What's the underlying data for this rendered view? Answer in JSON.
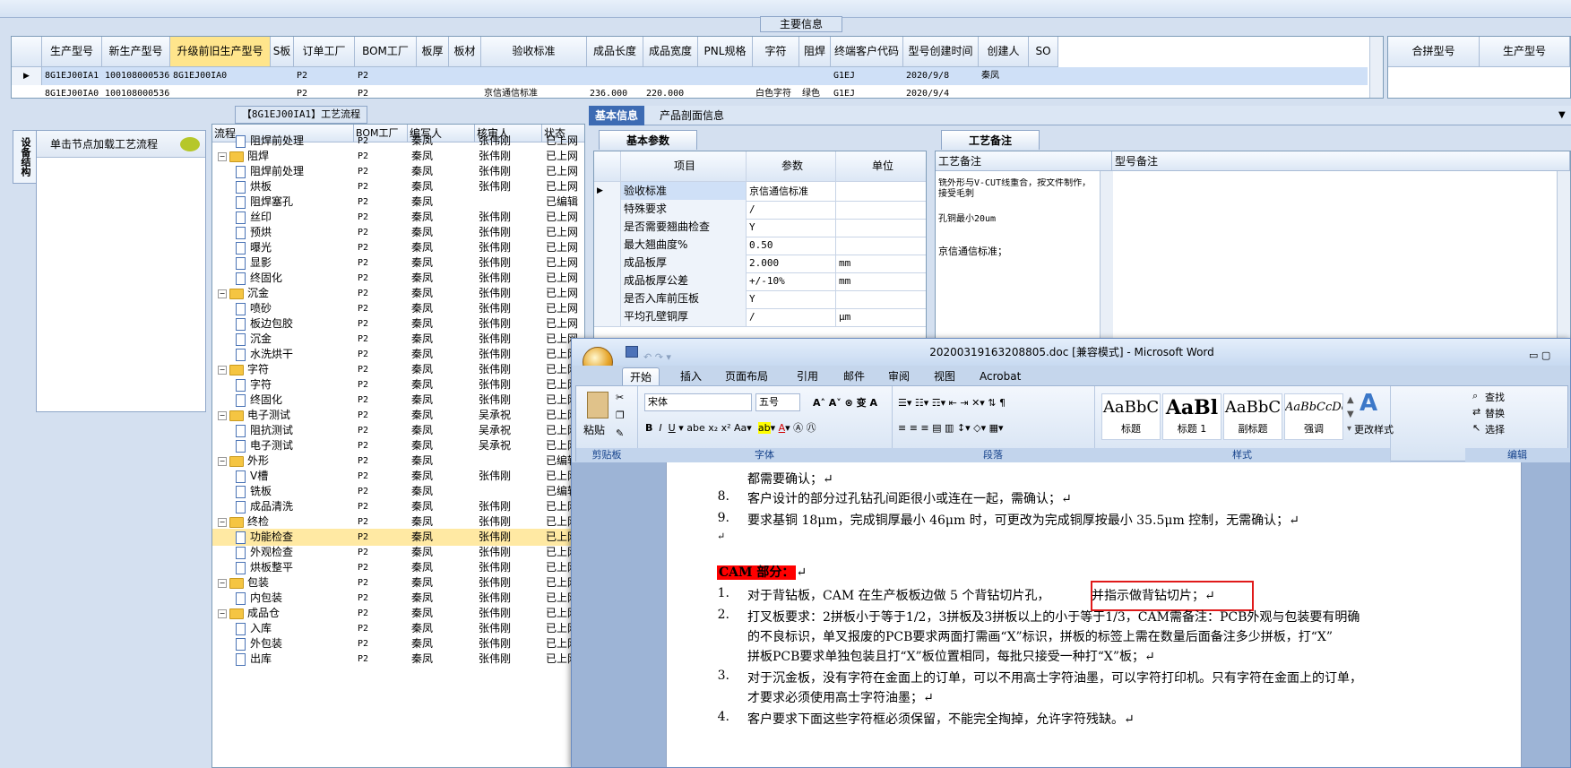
{
  "main_info": {
    "legend": "主要信息",
    "columns": [
      "生产型号",
      "新生产型号",
      "升级前旧生产型号",
      "S板",
      "订单工厂",
      "BOM工厂",
      "板厚",
      "板材",
      "验收标准",
      "成品长度",
      "成品宽度",
      "PNL规格",
      "字符",
      "阻焊",
      "终端客户代码",
      "型号创建时间",
      "创建人",
      "SO"
    ],
    "rows": [
      [
        "8G1EJ00IA1",
        "10010800053697",
        "8G1EJ00IA0",
        "",
        "P2",
        "P2",
        "",
        "",
        "",
        "",
        "",
        "",
        "",
        "",
        "G1EJ",
        "2020/9/8",
        "秦凤",
        ""
      ],
      [
        "8G1EJ00IA0",
        "10010800053697",
        "",
        "",
        "P2",
        "P2",
        "",
        "",
        "京信通信标准",
        "236.000",
        "220.000",
        "",
        "白色字符",
        "绿色",
        "G1EJ",
        "2020/9/4",
        "",
        ""
      ]
    ]
  },
  "merge_grid": {
    "columns": [
      "合拼型号",
      "生产型号"
    ]
  },
  "left_pane": {
    "title": "【8G1EJ00IA1】工艺流程",
    "vertical_tab": "设备结构",
    "node_hint": "单击节点加载工艺流程"
  },
  "tree": {
    "columns": [
      "流程",
      "BOM工厂",
      "编写人",
      "核审人",
      "状态"
    ],
    "rows": [
      {
        "label": "阻焊前处理",
        "level": 1,
        "bom": "P2",
        "writer": "秦凤",
        "reviewer": "张伟刚",
        "status": "已上网",
        "partial": true
      },
      {
        "label": "阻焊",
        "level": 0,
        "bom": "P2",
        "writer": "秦凤",
        "reviewer": "张伟刚",
        "status": "已上网"
      },
      {
        "label": "阻焊前处理",
        "level": 1,
        "bom": "P2",
        "writer": "秦凤",
        "reviewer": "张伟刚",
        "status": "已上网"
      },
      {
        "label": "烘板",
        "level": 1,
        "bom": "P2",
        "writer": "秦凤",
        "reviewer": "张伟刚",
        "status": "已上网"
      },
      {
        "label": "阻焊塞孔",
        "level": 1,
        "bom": "P2",
        "writer": "秦凤",
        "reviewer": "",
        "status": "已编辑"
      },
      {
        "label": "丝印",
        "level": 1,
        "bom": "P2",
        "writer": "秦凤",
        "reviewer": "张伟刚",
        "status": "已上网"
      },
      {
        "label": "预烘",
        "level": 1,
        "bom": "P2",
        "writer": "秦凤",
        "reviewer": "张伟刚",
        "status": "已上网"
      },
      {
        "label": "曝光",
        "level": 1,
        "bom": "P2",
        "writer": "秦凤",
        "reviewer": "张伟刚",
        "status": "已上网"
      },
      {
        "label": "显影",
        "level": 1,
        "bom": "P2",
        "writer": "秦凤",
        "reviewer": "张伟刚",
        "status": "已上网"
      },
      {
        "label": "终固化",
        "level": 1,
        "bom": "P2",
        "writer": "秦凤",
        "reviewer": "张伟刚",
        "status": "已上网"
      },
      {
        "label": "沉金",
        "level": 0,
        "bom": "P2",
        "writer": "秦凤",
        "reviewer": "张伟刚",
        "status": "已上网"
      },
      {
        "label": "喷砂",
        "level": 1,
        "bom": "P2",
        "writer": "秦凤",
        "reviewer": "张伟刚",
        "status": "已上网"
      },
      {
        "label": "板边包胶",
        "level": 1,
        "bom": "P2",
        "writer": "秦凤",
        "reviewer": "张伟刚",
        "status": "已上网"
      },
      {
        "label": "沉金",
        "level": 1,
        "bom": "P2",
        "writer": "秦凤",
        "reviewer": "张伟刚",
        "status": "已上网"
      },
      {
        "label": "水洗烘干",
        "level": 1,
        "bom": "P2",
        "writer": "秦凤",
        "reviewer": "张伟刚",
        "status": "已上网"
      },
      {
        "label": "字符",
        "level": 0,
        "bom": "P2",
        "writer": "秦凤",
        "reviewer": "张伟刚",
        "status": "已上网"
      },
      {
        "label": "字符",
        "level": 1,
        "bom": "P2",
        "writer": "秦凤",
        "reviewer": "张伟刚",
        "status": "已上网"
      },
      {
        "label": "终固化",
        "level": 1,
        "bom": "P2",
        "writer": "秦凤",
        "reviewer": "张伟刚",
        "status": "已上网"
      },
      {
        "label": "电子测试",
        "level": 0,
        "bom": "P2",
        "writer": "秦凤",
        "reviewer": "吴承祝",
        "status": "已上网"
      },
      {
        "label": "阻抗测试",
        "level": 1,
        "bom": "P2",
        "writer": "秦凤",
        "reviewer": "吴承祝",
        "status": "已上网"
      },
      {
        "label": "电子测试",
        "level": 1,
        "bom": "P2",
        "writer": "秦凤",
        "reviewer": "吴承祝",
        "status": "已上网"
      },
      {
        "label": "外形",
        "level": 0,
        "bom": "P2",
        "writer": "秦凤",
        "reviewer": "",
        "status": "已编辑"
      },
      {
        "label": "V槽",
        "level": 1,
        "bom": "P2",
        "writer": "秦凤",
        "reviewer": "张伟刚",
        "status": "已上网"
      },
      {
        "label": "铣板",
        "level": 1,
        "bom": "P2",
        "writer": "秦凤",
        "reviewer": "",
        "status": "已编辑"
      },
      {
        "label": "成品清洗",
        "level": 1,
        "bom": "P2",
        "writer": "秦凤",
        "reviewer": "张伟刚",
        "status": "已上网"
      },
      {
        "label": "终检",
        "level": 0,
        "bom": "P2",
        "writer": "秦凤",
        "reviewer": "张伟刚",
        "status": "已上网"
      },
      {
        "label": "功能检查",
        "level": 1,
        "bom": "P2",
        "writer": "秦凤",
        "reviewer": "张伟刚",
        "status": "已上网",
        "selected": true
      },
      {
        "label": "外观检查",
        "level": 1,
        "bom": "P2",
        "writer": "秦凤",
        "reviewer": "张伟刚",
        "status": "已上网"
      },
      {
        "label": "烘板整平",
        "level": 1,
        "bom": "P2",
        "writer": "秦凤",
        "reviewer": "张伟刚",
        "status": "已上网"
      },
      {
        "label": "包装",
        "level": 0,
        "bom": "P2",
        "writer": "秦凤",
        "reviewer": "张伟刚",
        "status": "已上网"
      },
      {
        "label": "内包装",
        "level": 1,
        "bom": "P2",
        "writer": "秦凤",
        "reviewer": "张伟刚",
        "status": "已上网"
      },
      {
        "label": "成品仓",
        "level": 0,
        "bom": "P2",
        "writer": "秦凤",
        "reviewer": "张伟刚",
        "status": "已上网"
      },
      {
        "label": "入库",
        "level": 1,
        "bom": "P2",
        "writer": "秦凤",
        "reviewer": "张伟刚",
        "status": "已上网"
      },
      {
        "label": "外包装",
        "level": 1,
        "bom": "P2",
        "writer": "秦凤",
        "reviewer": "张伟刚",
        "status": "已上网"
      },
      {
        "label": "出库",
        "level": 1,
        "bom": "P2",
        "writer": "秦凤",
        "reviewer": "张伟刚",
        "status": "已上网"
      }
    ]
  },
  "right_tabs": [
    "基本信息",
    "产品剖面信息"
  ],
  "param_tab": "基本参数",
  "param_grid": {
    "columns": [
      "项目",
      "参数",
      "单位"
    ],
    "rows": [
      [
        "验收标准",
        "京信通信标准",
        ""
      ],
      [
        "特殊要求",
        "/",
        ""
      ],
      [
        "是否需要翘曲检查",
        "Y",
        ""
      ],
      [
        "最大翘曲度%",
        "0.50",
        ""
      ],
      [
        "成品板厚",
        "2.000",
        "mm"
      ],
      [
        "成品板厚公差",
        "+/-10%",
        "mm"
      ],
      [
        "是否入库前压板",
        "Y",
        ""
      ],
      [
        "平均孔壁铜厚",
        "/",
        "μm"
      ]
    ]
  },
  "craft_tab": "工艺备注",
  "craft_grid": {
    "columns": [
      "工艺备注",
      "型号备注"
    ],
    "notes": [
      "铣外形与V-CUT线重合，按文件制作，接受毛刺",
      "孔铜最小20um",
      "京信通信标准；"
    ]
  },
  "word": {
    "title": "20200319163208805.doc [兼容模式] - Microsoft Word",
    "tabs": [
      "开始",
      "插入",
      "页面布局",
      "引用",
      "邮件",
      "审阅",
      "视图",
      "Acrobat"
    ],
    "clipboard": {
      "paste": "粘贴",
      "label": "剪贴板"
    },
    "font": {
      "name": "宋体",
      "size": "五号",
      "label": "字体"
    },
    "paragraph_label": "段落",
    "styles": [
      {
        "sample": "AaBbC",
        "name": "标题"
      },
      {
        "sample": "AaBl",
        "name": "标题 1"
      },
      {
        "sample": "AaBbC",
        "name": "副标题"
      },
      {
        "sample": "AaBbCcDc",
        "name": "强调"
      }
    ],
    "change_styles": "更改样式",
    "styles_label": "样式",
    "editing": {
      "find": "查找",
      "replace": "替换",
      "select": "选择",
      "label": "编辑"
    },
    "doc_lines": {
      "partial_top": "都需要确认；↵",
      "l8": {
        "num": "8.",
        "text": "客户设计的部分过孔钻孔间距很小或连在一起，需确认；↵"
      },
      "l9": {
        "num": "9.",
        "text": "要求基铜 18μm，完成铜厚最小 46μm 时，可更改为完成铜厚按最小 35.5μm 控制，无需确认；↵"
      },
      "empty": "↵",
      "cam_heading": "CAM 部分：",
      "cam_tail": "↵",
      "c1a": {
        "num": "1.",
        "text": "对于背钻板，CAM 在生产板板边做 5 个背钻切片孔，"
      },
      "c1b": "并指示做背钻切片；↵",
      "c2a": {
        "num": "2.",
        "text": "打叉板要求：2拼板小于等于1/2，3拼板及3拼板以上的小于等于1/3，CAM需备注：PCB外观与包装要有明确"
      },
      "c2b": "的不良标识，单叉报废的PCB要求两面打需画“X”标识，拼板的标签上需在数量后面备注多少拼板，打“X”",
      "c2c": "拼板PCB要求单独包装且打“X”板位置相同，每批只接受一种打“X”板；↵",
      "c3a": {
        "num": "3.",
        "text": "对于沉金板，没有字符在金面上的订单，可以不用高士字符油墨，可以字符打印机。只有字符在金面上的订单，"
      },
      "c3b": "才要求必须使用高士字符油墨；↵",
      "c4": {
        "num": "4.",
        "text": "客户要求下面这些字符框必须保留，不能完全掏掉，允许字符残缺。↵"
      }
    }
  }
}
